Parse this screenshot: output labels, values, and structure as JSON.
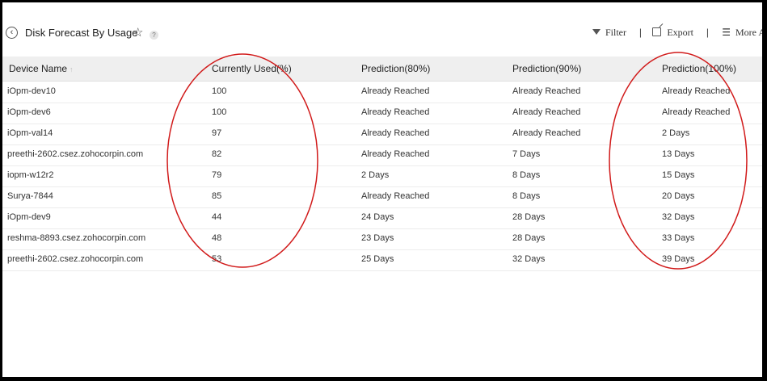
{
  "header": {
    "title": "Disk Forecast By Usage",
    "back_icon": "back-arrow-icon",
    "star_icon": "star-outline-icon",
    "help_icon": "help-icon",
    "help_glyph": "?"
  },
  "toolbar": {
    "filter_label": "Filter",
    "export_label": "Export",
    "more_label": "More A",
    "separator": "|"
  },
  "table": {
    "columns": [
      "Device Name",
      "Currently Used(%)",
      "Prediction(80%)",
      "Prediction(90%)",
      "Prediction(100%)"
    ],
    "rows": [
      [
        "iOpm-dev10",
        "100",
        "Already Reached",
        "Already Reached",
        "Already Reached"
      ],
      [
        "iOpm-dev6",
        "100",
        "Already Reached",
        "Already Reached",
        "Already Reached"
      ],
      [
        "iOpm-val14",
        "97",
        "Already Reached",
        "Already Reached",
        "2 Days"
      ],
      [
        "preethi-2602.csez.zohocorpin.com",
        "82",
        "Already Reached",
        "7 Days",
        "13 Days"
      ],
      [
        "iopm-w12r2",
        "79",
        "2 Days",
        "8 Days",
        "15 Days"
      ],
      [
        "Surya-7844",
        "85",
        "Already Reached",
        "8 Days",
        "20 Days"
      ],
      [
        "iOpm-dev9",
        "44",
        "24 Days",
        "28 Days",
        "32 Days"
      ],
      [
        "reshma-8893.csez.zohocorpin.com",
        "48",
        "23 Days",
        "28 Days",
        "33 Days"
      ],
      [
        "preethi-2602.csez.zohocorpin.com",
        "53",
        "25 Days",
        "32 Days",
        "39 Days"
      ]
    ]
  },
  "colors": {
    "annotation_circle": "#d11a1a",
    "header_bg": "#efefef"
  }
}
